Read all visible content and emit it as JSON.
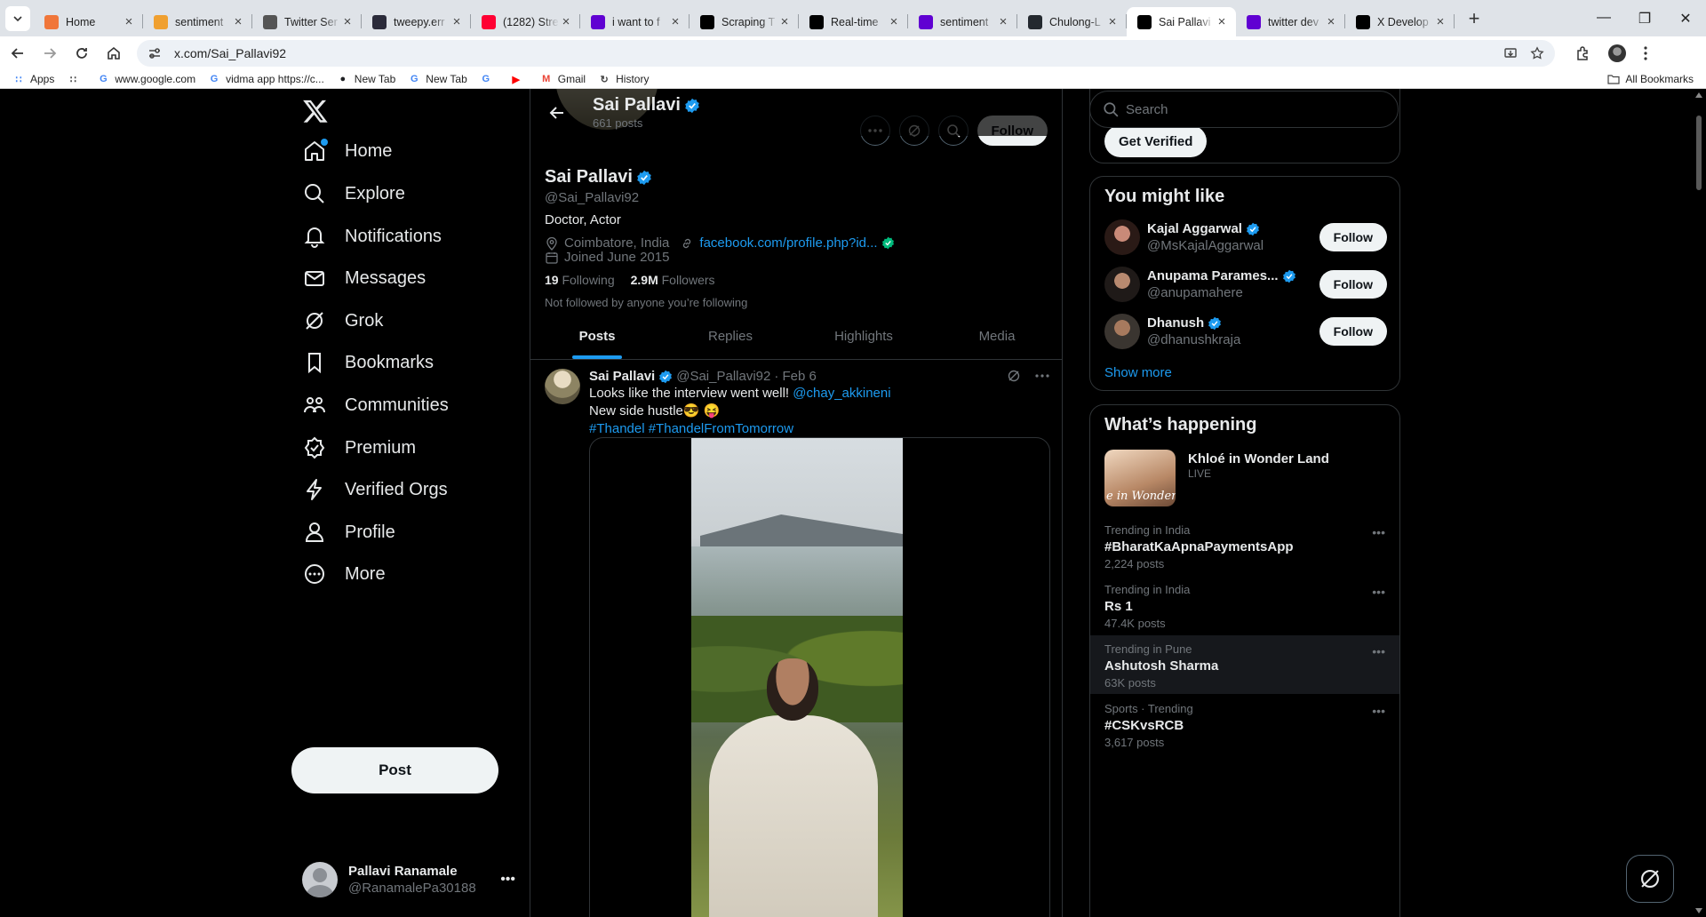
{
  "browser": {
    "tabs": [
      {
        "label": "Home",
        "icon": "loading-icon",
        "color": "#f0763a",
        "active": false
      },
      {
        "label": "sentiment",
        "icon": "orange-doc-icon",
        "color": "#f0a030",
        "active": false
      },
      {
        "label": "Twitter Ser",
        "icon": "settings-icon",
        "color": "#555555",
        "active": false
      },
      {
        "label": "tweepy.err",
        "icon": "terminal-icon",
        "color": "#2b2b3a",
        "active": false
      },
      {
        "label": "(1282) Stre",
        "icon": "youtube-icon",
        "color": "#ff0033",
        "active": false
      },
      {
        "label": "i want to f",
        "icon": "yahoo-icon",
        "color": "#6001d2",
        "active": false
      },
      {
        "label": "Scraping T",
        "icon": "medium-icon",
        "color": "#000000",
        "active": false
      },
      {
        "label": "Real-time",
        "icon": "medium-icon",
        "color": "#000000",
        "active": false
      },
      {
        "label": "sentiment",
        "icon": "yahoo-icon",
        "color": "#6001d2",
        "active": false
      },
      {
        "label": "Chulong-L",
        "icon": "github-icon",
        "color": "#24292f",
        "active": false
      },
      {
        "label": "Sai Pallavi",
        "icon": "x-icon",
        "color": "#000000",
        "active": true
      },
      {
        "label": "twitter dev",
        "icon": "yahoo-icon",
        "color": "#6001d2",
        "active": false
      },
      {
        "label": "X Develop",
        "icon": "x-icon",
        "color": "#000000",
        "active": false
      }
    ],
    "url": "x.com/Sai_Pallavi92",
    "bookmarks": [
      {
        "label": "Apps",
        "icon": "apps-grid-icon"
      },
      {
        "label": "",
        "icon": "grid-icon"
      },
      {
        "label": "www.google.com",
        "icon": "google-icon"
      },
      {
        "label": "vidma app https://c...",
        "icon": "google-icon"
      },
      {
        "label": "New Tab",
        "icon": "chrome-icon"
      },
      {
        "label": "New Tab",
        "icon": "google-icon"
      },
      {
        "label": "",
        "icon": "google-icon"
      },
      {
        "label": "",
        "icon": "youtube-icon"
      },
      {
        "label": "Gmail",
        "icon": "gmail-icon"
      },
      {
        "label": "History",
        "icon": "history-icon"
      }
    ],
    "all_bookmarks": "All Bookmarks"
  },
  "nav": {
    "items": [
      {
        "label": "Home",
        "icon": "home-icon"
      },
      {
        "label": "Explore",
        "icon": "search-icon"
      },
      {
        "label": "Notifications",
        "icon": "bell-icon"
      },
      {
        "label": "Messages",
        "icon": "mail-icon"
      },
      {
        "label": "Grok",
        "icon": "grok-icon"
      },
      {
        "label": "Bookmarks",
        "icon": "bookmark-icon"
      },
      {
        "label": "Communities",
        "icon": "communities-icon"
      },
      {
        "label": "Premium",
        "icon": "premium-icon"
      },
      {
        "label": "Verified Orgs",
        "icon": "lightning-icon"
      },
      {
        "label": "Profile",
        "icon": "person-icon"
      },
      {
        "label": "More",
        "icon": "more-circle-icon"
      }
    ],
    "post_label": "Post",
    "account": {
      "name": "Pallavi Ranamale",
      "handle": "@RanamalePa30188"
    }
  },
  "profile": {
    "header_name": "Sai Pallavi",
    "header_posts": "661 posts",
    "follow_label": "Follow",
    "name": "Sai Pallavi",
    "handle": "@Sai_Pallavi92",
    "bio": "Doctor, Actor",
    "location": "Coimbatore, India",
    "link": "facebook.com/profile.php?id...",
    "joined": "Joined June 2015",
    "following_count": "19",
    "following_label": "Following",
    "followers_count": "2.9M",
    "followers_label": "Followers",
    "note": "Not followed by anyone you’re following",
    "tabs": [
      "Posts",
      "Replies",
      "Highlights",
      "Media"
    ]
  },
  "tweet": {
    "name": "Sai Pallavi",
    "handle": "@Sai_Pallavi92",
    "date": "· Feb 6",
    "line1": "Looks like the interview went well! ",
    "mention": "@chay_akkineni",
    "line2": "New side hustle😎 😝",
    "hashtags": "#Thandel #ThandelFromTomorrow"
  },
  "right": {
    "search_placeholder": "Search",
    "get_verified": "Get Verified",
    "you_might_like_title": "You might like",
    "suggestions": [
      {
        "name": "Kajal Aggarwal",
        "handle": "@MsKajalAggarwal",
        "follow": "Follow"
      },
      {
        "name": "Anupama Parames...",
        "handle": "@anupamahere",
        "follow": "Follow"
      },
      {
        "name": "Dhanush",
        "handle": "@dhanushkraja",
        "follow": "Follow"
      }
    ],
    "show_more": "Show more",
    "happening_title": "What’s happening",
    "live": {
      "title": "Khloé in Wonder Land",
      "tag": "LIVE",
      "thumb_text": "e in Wonder l"
    },
    "trends": [
      {
        "context": "Trending in India",
        "title": "#BharatKaApnaPaymentsApp",
        "posts": "2,224 posts"
      },
      {
        "context": "Trending in India",
        "title": "Rs 1",
        "posts": "47.4K posts"
      },
      {
        "context": "Trending in Pune",
        "title": "Ashutosh Sharma",
        "posts": "63K posts"
      },
      {
        "context": "Sports · Trending",
        "title": "#CSKvsRCB",
        "posts": "3,617 posts"
      }
    ]
  },
  "colors": {
    "accent": "#1d9bf0",
    "verified": "#1d9bf0",
    "link_verified": "#00ba7c"
  }
}
